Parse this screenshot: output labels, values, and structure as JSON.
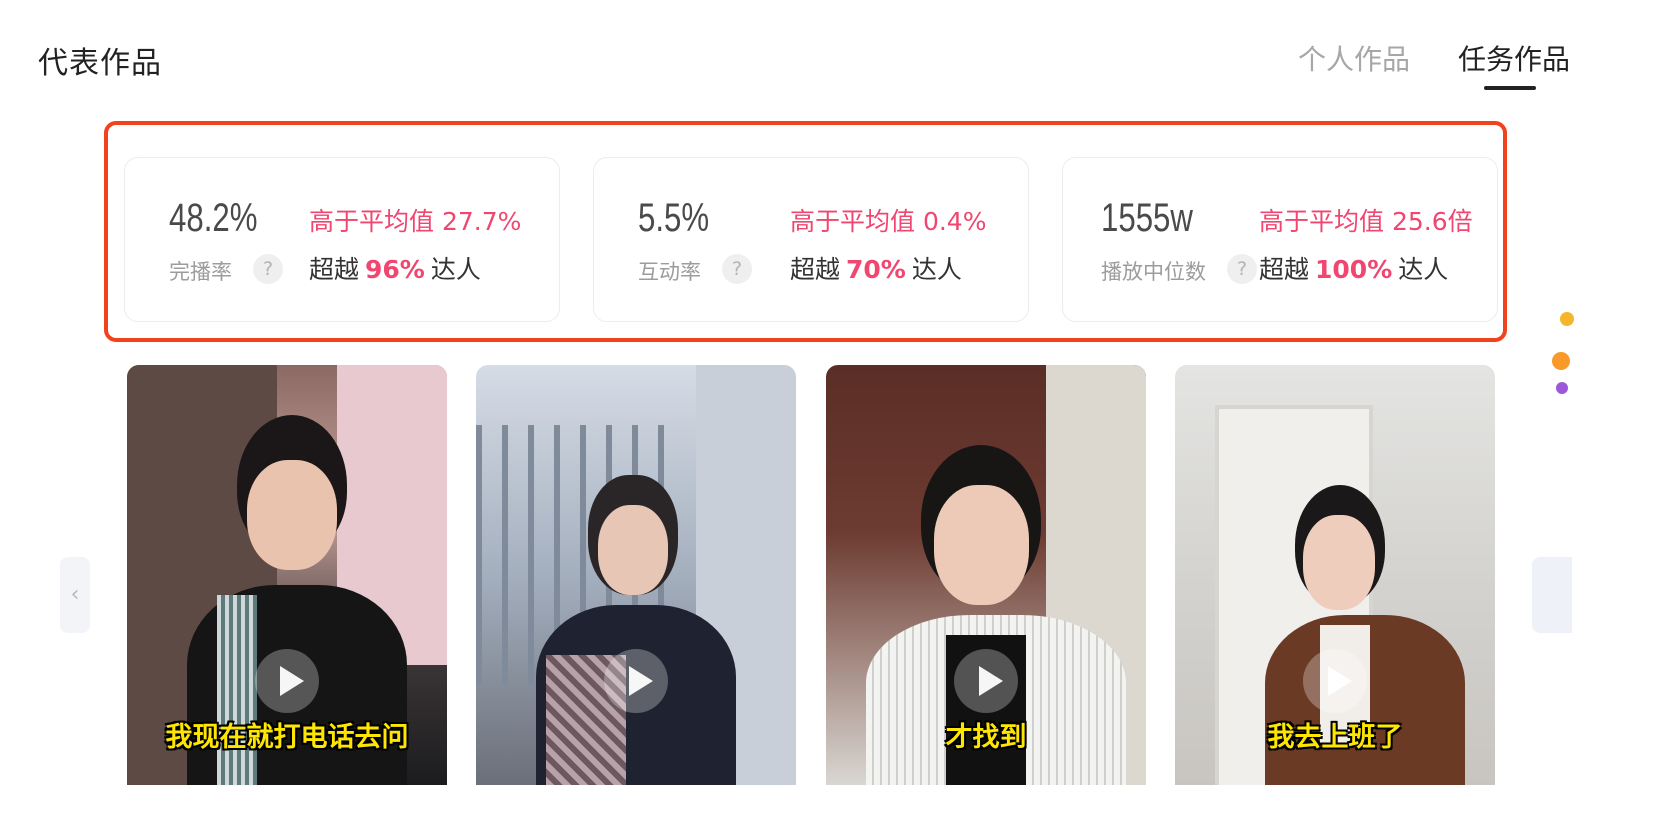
{
  "header": {
    "title": "代表作品",
    "tabs": [
      {
        "label": "个人作品",
        "active": false
      },
      {
        "label": "任务作品",
        "active": true
      }
    ]
  },
  "stats": [
    {
      "value": "48.2%",
      "label": "完播率",
      "help": "?",
      "avg_text": "高于平均值 27.7%",
      "exceed_prefix": "超越",
      "exceed_pct": "96%",
      "exceed_suffix": "达人"
    },
    {
      "value": "5.5%",
      "label": "互动率",
      "help": "?",
      "avg_text": "高于平均值 0.4%",
      "exceed_prefix": "超越",
      "exceed_pct": "70%",
      "exceed_suffix": "达人"
    },
    {
      "value": "1555w",
      "label": "播放中位数",
      "help": "?",
      "avg_text": "高于平均值 25.6倍",
      "exceed_prefix": "超越",
      "exceed_pct": "100%",
      "exceed_suffix": "达人"
    }
  ],
  "videos": [
    {
      "caption": "我现在就打电话去问"
    },
    {
      "caption": ""
    },
    {
      "caption": "才找到"
    },
    {
      "caption": "我去上班了"
    }
  ],
  "nav": {
    "prev_symbol": "‹"
  },
  "colors": {
    "accent_pink": "#f0466f",
    "highlight_red": "#f2421d",
    "caption_yellow": "#ffe600"
  }
}
